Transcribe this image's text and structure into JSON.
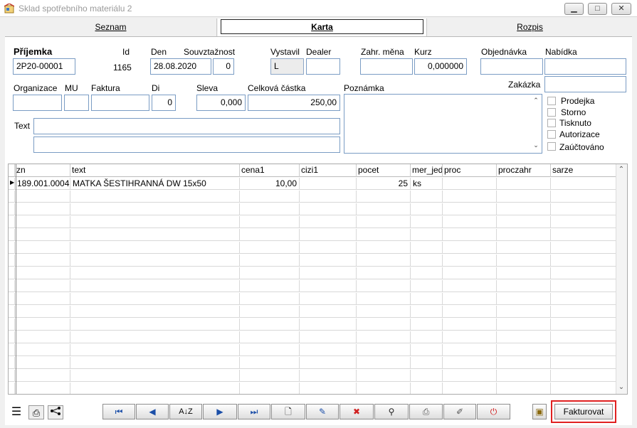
{
  "window": {
    "title": "Sklad spotřebního materiálu 2"
  },
  "tabs": [
    {
      "label": "Seznam"
    },
    {
      "label": "Karta"
    },
    {
      "label": "Rozpis"
    }
  ],
  "form": {
    "prijemka_label": "Příjemka",
    "prijemka_value": "2P20-00001",
    "id_label": "Id",
    "id_value": "1165",
    "den_label": "Den",
    "den_value": "28.08.2020",
    "souvztaznost_label": "Souvztažnost",
    "souvztaznost_value": "0",
    "vystavil_label": "Vystavil",
    "vystavil_value": "L",
    "dealer_label": "Dealer",
    "dealer_value": "",
    "zahr_mena_label": "Zahr. měna",
    "zahr_mena_value": "",
    "kurz_label": "Kurz",
    "kurz_value": "0,000000",
    "objednavka_label": "Objednávka",
    "objednavka_value": "",
    "nabidka_label": "Nabídka",
    "nabidka_value": "",
    "zakazka_label": "Zakázka",
    "zakazka_value": "",
    "organizace_label": "Organizace",
    "mu_label": "MU",
    "faktura_label": "Faktura",
    "di_label": "Di",
    "di_value": "0",
    "sleva_label": "Sleva",
    "sleva_value": "0,000",
    "celkova_castka_label": "Celková částka",
    "celkova_castka_value": "250,00",
    "poznamka_label": "Poznámka",
    "poznamka_value": "",
    "text_label": "Text",
    "text_value_1": "",
    "text_value_2": "",
    "checkboxes": [
      {
        "label": "Prodejka",
        "checked": false
      },
      {
        "label": "Storno",
        "checked": false
      },
      {
        "label": "Tisknuto",
        "checked": false
      },
      {
        "label": "Autorizace",
        "checked": false
      },
      {
        "label": "Zaúčtováno",
        "checked": false
      }
    ]
  },
  "grid": {
    "columns": [
      "zn",
      "text",
      "cena1",
      "cizi1",
      "pocet",
      "mer_jed",
      "proc",
      "proczahr",
      "sarze"
    ],
    "rows": [
      {
        "zn": "189.001.0004",
        "text": "MATKA ŠESTIHRANNÁ DW 15x50",
        "cena1": "10,00",
        "cizi1": "",
        "pocet": "25",
        "mer_jed": "ks",
        "proc": "",
        "proczahr": "",
        "sarze": ""
      }
    ]
  },
  "toolbar": {
    "fakturovat_label": "Fakturovat"
  },
  "colors": {
    "accent_border": "#e02020",
    "field_border": "#7a9cc4",
    "icon_blue": "#1c4fa8"
  }
}
